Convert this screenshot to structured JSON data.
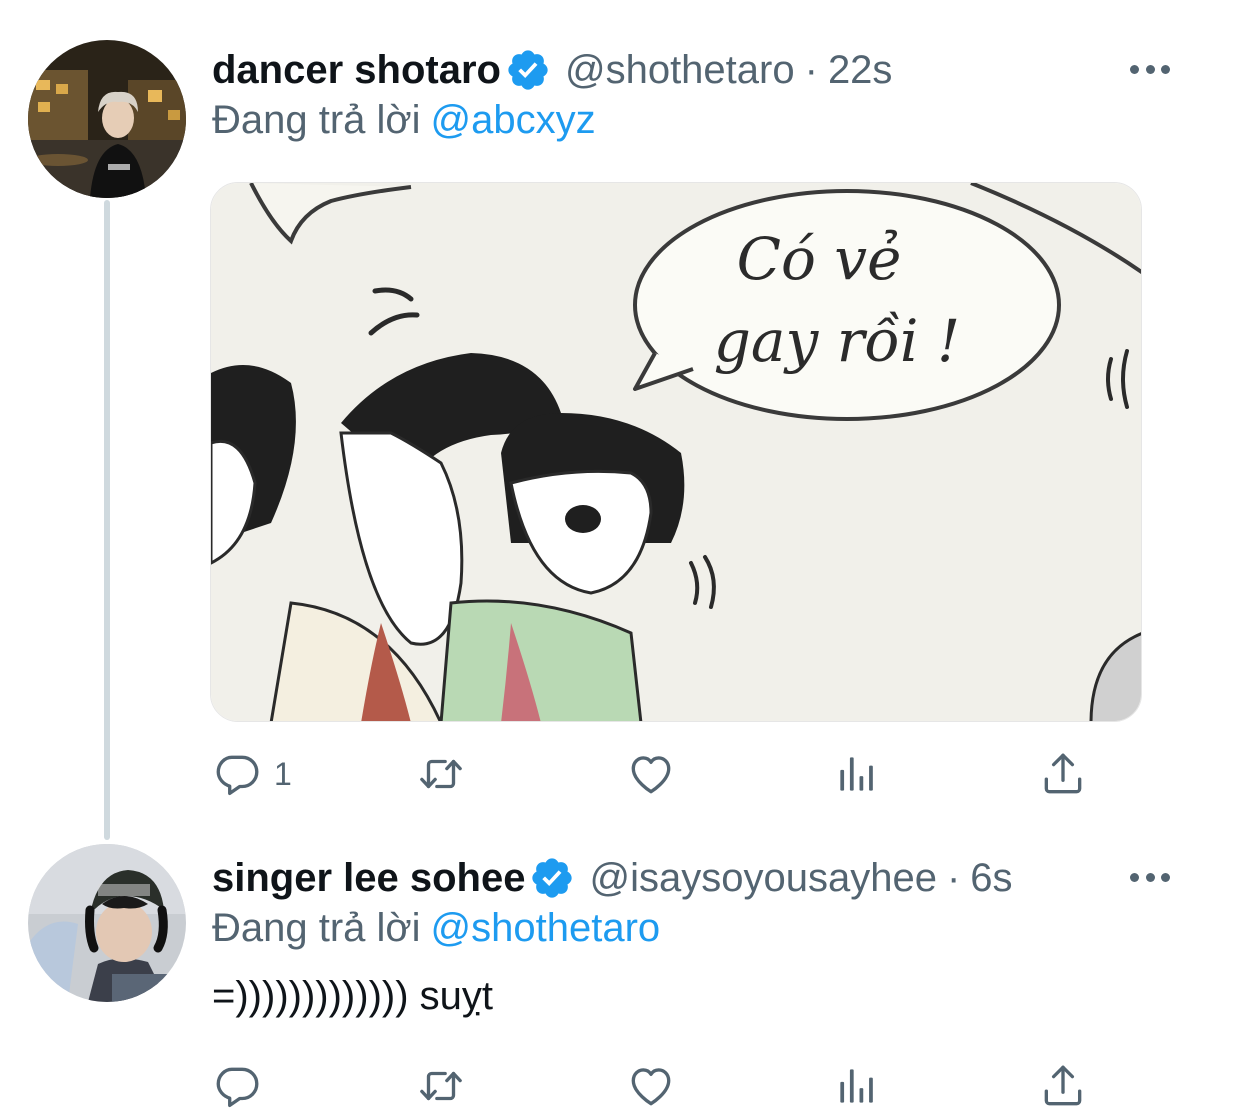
{
  "tweets": [
    {
      "display_name": "dancer shotaro",
      "handle": "@shothetaro",
      "separator": "·",
      "time": "22s",
      "replying_prefix": "Đang trả lời",
      "replying_to": "@abcxyz",
      "text": "",
      "image": {
        "bubble_line1": "Có vẻ",
        "bubble_line2": "gay rồi !"
      },
      "actions": {
        "reply_count": "1",
        "retweet_count": "",
        "like_count": ""
      }
    },
    {
      "display_name": "singer lee sohee",
      "handle": "@isaysoyousayhee",
      "separator": "·",
      "time": "6s",
      "replying_prefix": "Đang trả lời",
      "replying_to": "@shothetaro",
      "text": "=))))))))))))) suỵt",
      "actions": {
        "reply_count": "",
        "retweet_count": "",
        "like_count": ""
      }
    }
  ],
  "colors": {
    "accent": "#1d9bf0",
    "secondary_text": "#536471",
    "primary_text": "#0f1419",
    "thread_line": "#cfd9de"
  },
  "icons": [
    "verified-badge-icon",
    "more-icon",
    "reply-icon",
    "retweet-icon",
    "like-icon",
    "views-icon",
    "share-icon"
  ]
}
